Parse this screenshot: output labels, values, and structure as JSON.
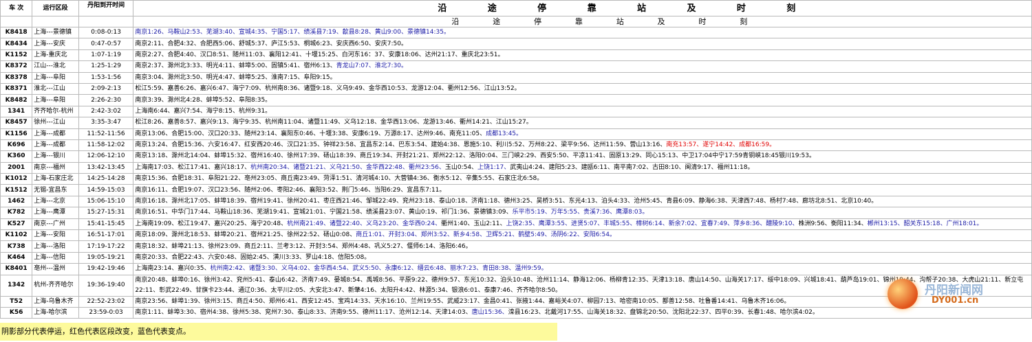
{
  "header": {
    "col_train": "车  次",
    "col_section": "运行区段",
    "col_time": "丹阳到开时间",
    "title_chars": [
      "沿",
      "途",
      "停",
      "靠",
      "站",
      "及",
      "时",
      "刻"
    ],
    "subtitle_chars": [
      "沿",
      "途",
      "停",
      "靠",
      "站",
      "及",
      "时",
      "刻"
    ]
  },
  "rows": [
    {
      "train": "K8418",
      "section": "上海---景德镇",
      "time": "0:08-0:13",
      "stops": [
        {
          "t": "南京1:26、马鞍山2:53、芜湖3:40、宣城4:35、宁国5:17、绩溪县7:19、歙县8:28、黄山9:00、景德镇14:35。",
          "c": "blue"
        }
      ]
    },
    {
      "train": "K8434",
      "section": "上海---安庆",
      "time": "0:47-0:57",
      "stops": [
        {
          "t": "南京2:11、合肥4:32、合肥西5:06、舒城5:37、庐江5:53、桐城6:23、安庆西6:50、安庆7:50。",
          "c": ""
        }
      ]
    },
    {
      "train": "K1152",
      "section": "上海-重庆北",
      "time": "1:07-1:19",
      "stops": [
        {
          "t": "南京2:27、合肥4:40、汉口8:51、随州11:03、襄阳12:41、十堰15:25、白河东16：37、安康18:06、达州21:17、重庆北23:51。",
          "c": ""
        }
      ]
    },
    {
      "train": "K8372",
      "section": "江山---淮北",
      "time": "1:25-1:29",
      "stops": [
        {
          "t": "南京2:37、滁州北3:33、明光4:11、蚌埠5:00、固镇5:41、宿州6:13、",
          "c": ""
        },
        {
          "t": "青龙山7:07、淮北7:30。",
          "c": "blue"
        }
      ]
    },
    {
      "train": "K8378",
      "section": "上海---阜阳",
      "time": "1:53-1:56",
      "stops": [
        {
          "t": "南京3:04、滁州北3:50、明光4:47、蚌埠5:25、淮南7:15、阜阳9:15。",
          "c": ""
        }
      ]
    },
    {
      "train": "K8371",
      "section": "淮北---江山",
      "time": "2:09-2:13",
      "stops": [
        {
          "t": "松江5:59、嘉善6:26、嘉兴6:47、海宁7:09、杭州南8:36、诸暨9:18、义乌9:49、金华西10:53、龙游12:04、衢州12:56、江山13:52。",
          "c": ""
        }
      ]
    },
    {
      "train": "K8482",
      "section": "上海---阜阳",
      "time": "2:26-2:30",
      "stops": [
        {
          "t": "南京3:39、滁州北4:28、蚌埠5:52、阜阳8:35。",
          "c": ""
        }
      ]
    },
    {
      "train": "1341",
      "section": "齐齐哈尔-杭州",
      "time": "2:42-3:02",
      "stops": [
        {
          "t": "上海南6:44、嘉兴7:54、海宁8:15、杭州9:31。",
          "c": ""
        }
      ]
    },
    {
      "train": "K8457",
      "section": "徐州---江山",
      "time": "3:35-3:47",
      "stops": [
        {
          "t": "松江8:26、嘉善8:57、嘉兴9:13、海宁9:35、杭州南11:04、诸暨11:49、义乌12:18、金华西13:06、龙游13:46、衢州14:21、江山15:27。",
          "c": ""
        }
      ]
    },
    {
      "train": "K1156",
      "section": "上海---成都",
      "time": "11:52-11:56",
      "stops": [
        {
          "t": "南京13:06、合肥15:00、汉口20:33、随州23:14、襄阳东0:46、十堰3:38、安康6:19、万源8:17、达州9:46、南充11:05、",
          "c": ""
        },
        {
          "t": "成都13:45。",
          "c": "blue"
        }
      ]
    },
    {
      "train": "K696",
      "section": "上海---成都",
      "time": "11:58-12:02",
      "stops": [
        {
          "t": "南京13:24、合肥15:36、六安16:47、红安西20:46、汉口21:35、钟祥23:58、宜昌东2:14、巴东3:54、建始4:38、恩施5:10、利川5:52、万州8:22、梁平9:56、达州11:59、营山13:16、",
          "c": ""
        },
        {
          "t": "南充13:57、遂宁14:42、成都16:59。",
          "c": "red"
        }
      ]
    },
    {
      "train": "K360",
      "section": "上海---银川",
      "time": "12:06-12:10",
      "stops": [
        {
          "t": "南京13:18、滁州北14:04、蚌埠15:32、宿州16:40、徐州17:39、砀山18:39、商丘19:34、开封21:21、郑州22:12、洛阳0:04、三门峡2:29、西安5:50、平凉11:41、固原13:29、同心15:13、中卫17:04中宁17:59青铜峡18:45银川19:53。",
          "c": ""
        }
      ]
    },
    {
      "train": "2001",
      "section": "南京---福州",
      "time": "13:42-13:45",
      "stops": [
        {
          "t": "上海南17:03、松江17:41、嘉兴18:17、",
          "c": ""
        },
        {
          "t": "杭州南20:34、诸暨21:21、义乌21:50、金华西22:48、衢州23:56、",
          "c": "blue"
        },
        {
          "t": "玉山0:54、",
          "c": ""
        },
        {
          "t": "上饶1:17、",
          "c": "blue"
        },
        {
          "t": "武夷山4:24、建阳5:23、建瓯6:11、南平南7:02、古田8:10、闽清9:17、福州11:18。",
          "c": ""
        }
      ]
    },
    {
      "train": "K1012",
      "section": "上海-石家庄北",
      "time": "14:25-14:28",
      "stops": [
        {
          "t": "南京15:36、合肥18:31、阜阳21:22、亳州23:05、商丘南23:49、菏泽1:51、清河城4:10、大营镇4:36、衡水5:12、辛集5:55、石家庄北6:58。",
          "c": ""
        }
      ]
    },
    {
      "train": "K1512",
      "section": "无锡-宜昌东",
      "time": "14:59-15:03",
      "stops": [
        {
          "t": "南京16:11、合肥19:07、汉口23:56、随州2:06、枣阳2:46、襄阳3:52、荆门5:46、当阳6:29、宜昌东7:11。",
          "c": ""
        }
      ]
    },
    {
      "train": "1462",
      "section": "上海---北京",
      "time": "15:06-15:10",
      "stops": [
        {
          "t": "南京16:18、滁州北17:05、蚌埠18:39、宿州19:41、徐州20:41、枣庄西21:46、邹城22:49、兖州23:18、泰山0:18、济南1:18、德州3:25、吴桥3:51、东光4:13、泊头4:33、沧州5:45、青县6:09、静海6:38、天津西7:48、杨村7:48、廊坊北8:51、北京10:40。",
          "c": ""
        }
      ]
    },
    {
      "train": "K782",
      "section": "上海---鹰潭",
      "time": "15:27-15:31",
      "stops": [
        {
          "t": "南京16:51、中华门17:44、马鞍山18:36、芜湖19:41、宣城21:01、宁国21:58、绩溪县23:07、黄山0:19、祁门1:36、景德镇3:09、",
          "c": ""
        },
        {
          "t": "乐平市5:19、万年5:55、贵溪7:36、鹰潭8:03。",
          "c": "blue"
        }
      ]
    },
    {
      "train": "K527",
      "section": "南京---广州",
      "time": "15:41-15:45",
      "stops": [
        {
          "t": "上海南19:09、松江19:47、嘉兴20:25、海宁20:48、",
          "c": ""
        },
        {
          "t": "杭州南21:49、诸暨22:40、义乌23:20、金华西0:24、",
          "c": "blue"
        },
        {
          "t": "衢州1:40、玉山2:11、",
          "c": ""
        },
        {
          "t": "上饶2:35、鹰潭3:55、进贤5:07、丰城5:55、樟树6:14、新余7:02、宜春7:49、萍乡8:36、醴陵9:10、",
          "c": "blue"
        },
        {
          "t": "株洲9:56、衡阳11:34、",
          "c": ""
        },
        {
          "t": "郴州13:15、韶关东15:18、广州18:01。",
          "c": "blue"
        }
      ]
    },
    {
      "train": "K1102",
      "section": "上海---安阳",
      "time": "16:51-17:01",
      "stops": [
        {
          "t": "南京18:09、滁州北18:53、蚌埠20:21、宿州21:25、徐州22:52、砀山0:08、",
          "c": ""
        },
        {
          "t": "商丘1:01、开封3:04、郑州3:52、新乡4:58、卫辉5:21、鹤壁5:49、汤阴6:22、安阳6:54。",
          "c": "blue"
        }
      ]
    },
    {
      "train": "K738",
      "section": "上海---洛阳",
      "time": "17:19-17:22",
      "stops": [
        {
          "t": "南京18:32、蚌埠21:13、徐州23:09、商丘2:11、兰考3:12、开封3:54、郑州4:48、巩义5:27、偃师6:14、洛阳6:46。",
          "c": ""
        }
      ]
    },
    {
      "train": "K464",
      "section": "上海---信阳",
      "time": "19:05-19:21",
      "stops": [
        {
          "t": "南京20:33、合肥22:43、六安0:48、固始2:45、潢川3:33、罗山4:18、信阳5:08。",
          "c": ""
        }
      ]
    },
    {
      "train": "K8401",
      "section": "亳州---温州",
      "time": "19:42-19:46",
      "stops": [
        {
          "t": "上海南23:14、嘉兴0:35、",
          "c": ""
        },
        {
          "t": "杭州南2:42、诸暨3:30、义乌4:02、金华西4:54、武义5:50、永康6:12、缙云6:48、丽水7:23、青田8:38、温州9:59。",
          "c": "blue"
        }
      ]
    },
    {
      "train": "1342",
      "section": "杭州-齐齐哈尔",
      "time": "19:36-19:40",
      "tall": true,
      "stops": [
        {
          "t": "南京20:48、蚌埠0:16、徐州3:42、兖州5:41、泰山6:42、济南7:49、晏城8:54、禹城8:56、平原9:22、德州9:57、东光10:32、泊头10:48、沧州11:14、静海12:06、杨柳青12:35、天津13:18、唐山14:50、山海关17:17、绥中18:09、兴城18:41、葫芦岛19:01、锦州19:44、沟帮子20:38、大虎山21:11、新立屯22:11、彰武22:49、甘旗卡23:44、通辽0:36、太平川2:05、大安北3:47、新肇4:16、太阳升4:42、林源5:34、银浪6:01、泰康7:46、齐齐哈尔8:50。",
          "c": ""
        }
      ]
    },
    {
      "train": "T52",
      "section": "上海-乌鲁木齐",
      "time": "22:52-23:02",
      "stops": [
        {
          "t": "南京23:56、蚌埠1:39、徐州3:15、商丘4:50、郑州6:41、西安12:45、宝鸡14:33、天水16:10、兰州19:55、武威23:17、金昌0:41、张掖1:44、嘉峪关4:07、柳园7:13、哈密南10:05、鄯善12:58、吐鲁番14:41、乌鲁木齐16:06。",
          "c": ""
        }
      ]
    },
    {
      "train": "K56",
      "section": "上海-哈尔滨",
      "time": "23:59-0:03",
      "stops": [
        {
          "t": "南京1:11、蚌埠3:30、宿州4:38、徐州5:38、兖州7:30、泰山8:33、济南9:55、德州11:17、沧州12:14、天津14:03、",
          "c": ""
        },
        {
          "t": "唐山15:36、",
          "c": "blue"
        },
        {
          "t": "滦县16:23、北戴河17:55、山海关18:32、盘锦北20:50、沈阳北22:37、四平0:39、长春1:48、哈尔滨4:02。",
          "c": ""
        }
      ]
    }
  ],
  "note": "阴影部分代表停运，红色代表区段改变，蓝色代表变点。",
  "watermark": {
    "brand": "丹阳新闻网",
    "domain": "DY001.cn"
  }
}
